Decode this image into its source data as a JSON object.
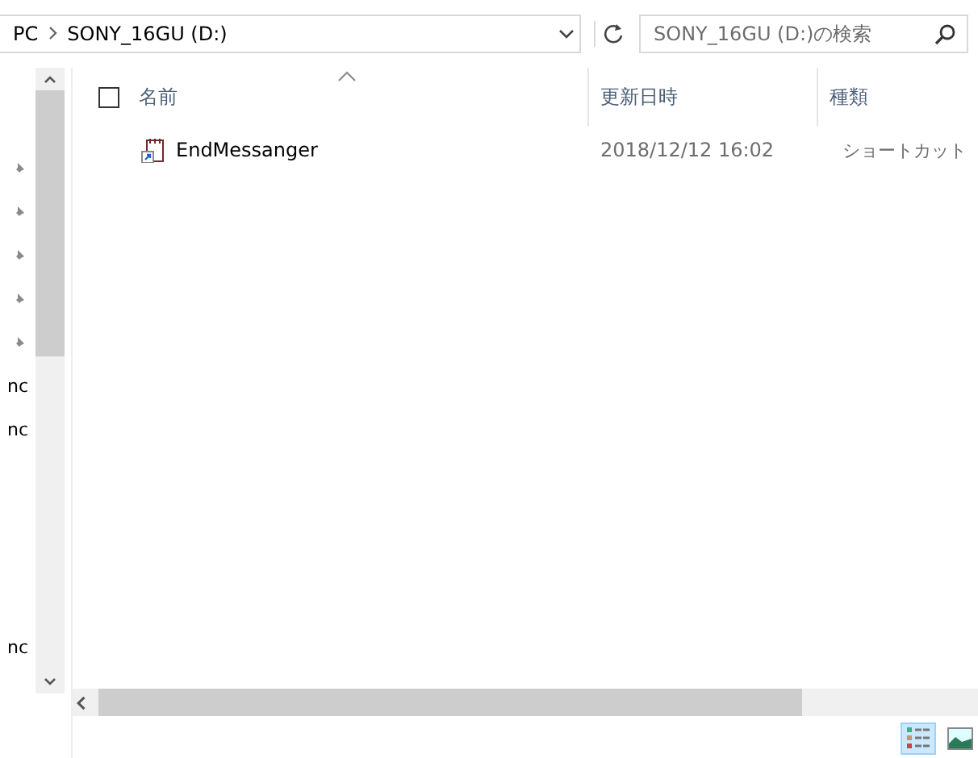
{
  "address_bar": {
    "path": [
      "PC",
      "SONY_16GU (D:)"
    ]
  },
  "search": {
    "placeholder": "SONY_16GU (D:)の検索"
  },
  "nav_pane": {
    "items": [
      {
        "kind": "pin"
      },
      {
        "kind": "pin"
      },
      {
        "kind": "pin"
      },
      {
        "kind": "pin"
      },
      {
        "kind": "pin"
      },
      {
        "kind": "text",
        "label": "nc"
      },
      {
        "kind": "text",
        "label": "nc"
      },
      {
        "kind": "gap"
      },
      {
        "kind": "gap"
      },
      {
        "kind": "gap"
      },
      {
        "kind": "gap"
      },
      {
        "kind": "text",
        "label": "nc"
      }
    ]
  },
  "table": {
    "select_all_checked": false,
    "columns": [
      {
        "label": "名前",
        "sorted": true
      },
      {
        "label": "更新日時",
        "sorted": false
      },
      {
        "label": "種類",
        "sorted": false
      }
    ],
    "rows": [
      {
        "name": "EndMessanger",
        "modified": "2018/12/12 16:02",
        "type": "ショートカット"
      }
    ]
  },
  "view_buttons": [
    {
      "kind": "details",
      "selected": true
    },
    {
      "kind": "large-icons",
      "selected": false
    }
  ]
}
